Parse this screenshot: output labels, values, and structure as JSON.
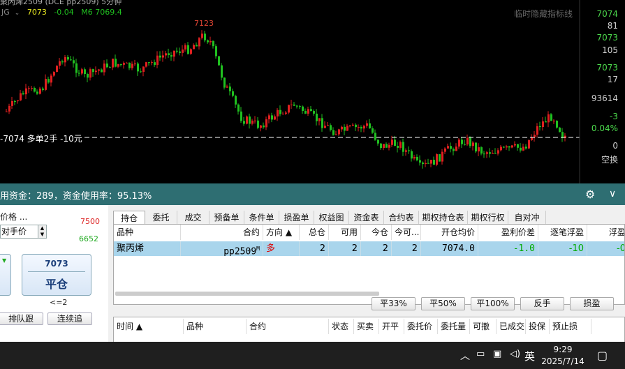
{
  "chart": {
    "title": "聚丙烯2509  (DCE pp2509)  5分钟",
    "indicator": "JG",
    "price": "7073",
    "change": "-0.04",
    "ma_label": "M6 7069.4",
    "peak_label": "7123",
    "hint": "临时隐藏指标线",
    "position_label": "-7074 多单2手 -10元",
    "right_labels": [
      {
        "text": "7074",
        "color": "#4cd84c"
      },
      {
        "text": "81",
        "color": "#cfcfcf"
      },
      {
        "text": "7073",
        "color": "#4cd84c"
      },
      {
        "text": "105",
        "color": "#cfcfcf"
      },
      {
        "text": "7073",
        "color": "#4cd84c"
      },
      {
        "text": "17",
        "color": "#cfcfcf"
      },
      {
        "text": "93614",
        "color": "#cfcfcf"
      },
      {
        "text": "-3",
        "color": "#4cd84c"
      },
      {
        "text": "0.04%",
        "color": "#4cd84c"
      },
      {
        "text": "0",
        "color": "#cfcfcf"
      },
      {
        "text": "空换",
        "color": "#cfcfcf"
      }
    ],
    "colors": {
      "up": "#e02020",
      "down": "#20c020",
      "header_price": "#e8e820",
      "header_change": "#20c020"
    }
  },
  "status": {
    "text": "用资金：289，资金使用率：95.13%",
    "icons": [
      "gear-icon",
      "chevron-down-icon"
    ]
  },
  "left_panel": {
    "price_type": "价格 ...",
    "price_mode": "对手价",
    "upper_limit": "7500",
    "lower_limit": "6652",
    "close_price": "7073",
    "close_label": "平仓",
    "close_qty": "<=2",
    "queue_label": "排队跟",
    "continuous_label": "连续追"
  },
  "tabs": [
    "持仓",
    "委托",
    "成交",
    "预备单",
    "条件单",
    "损盈单",
    "权益图",
    "资金表",
    "合约表",
    "期权持仓表",
    "期权行权",
    "自对冲"
  ],
  "positions": {
    "headers": [
      "品种",
      "合约",
      "方向 ▲",
      "总仓",
      "可用",
      "今仓",
      "今可...",
      "开仓均价",
      "盈利价差",
      "逐笔浮盈",
      "浮盈"
    ],
    "rows": [
      {
        "product": "聚丙烯",
        "contract": "pp2509",
        "contract_sup": "M",
        "direction": "多",
        "total": "2",
        "available": "2",
        "today": "2",
        "today_avail": "2",
        "avg_price": "7074.0",
        "profit_diff": "-1.0",
        "float_pnl": "-10",
        "float_pnl2": "-0"
      }
    ]
  },
  "actions": [
    "平33%",
    "平50%",
    "平100%",
    "反手",
    "损盈"
  ],
  "orders": {
    "headers": [
      "时间 ▲",
      "品种",
      "合约",
      "状态",
      "买卖",
      "开平",
      "委托价",
      "委托量",
      "可撤",
      "已成交",
      "投保",
      "预止损"
    ]
  },
  "taskbar": {
    "ime": "英",
    "time": "9:29",
    "date": "2025/7/14"
  }
}
